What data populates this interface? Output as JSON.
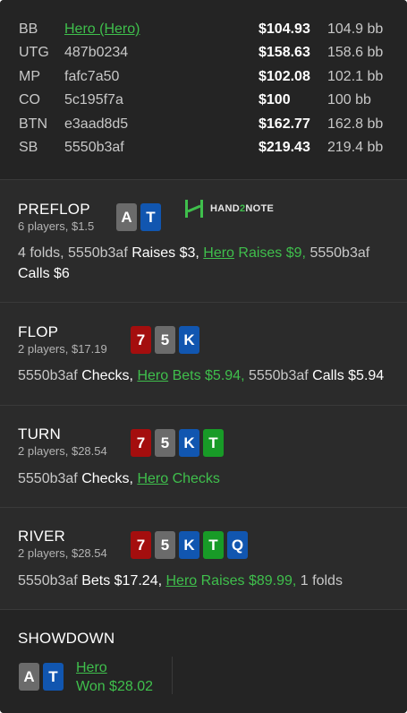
{
  "players": [
    {
      "pos": "BB",
      "name": "Hero (Hero)",
      "stack": "$104.93",
      "bb": "104.9 bb"
    },
    {
      "pos": "UTG",
      "name": "487b0234",
      "stack": "$158.63",
      "bb": "158.6 bb"
    },
    {
      "pos": "MP",
      "name": "fafc7a50",
      "stack": "$102.08",
      "bb": "102.1 bb"
    },
    {
      "pos": "CO",
      "name": "5c195f7a",
      "stack": "$100",
      "bb": "100 bb"
    },
    {
      "pos": "BTN",
      "name": "e3aad8d5",
      "stack": "$162.77",
      "bb": "162.8 bb"
    },
    {
      "pos": "SB",
      "name": "5550b3af",
      "stack": "$219.43",
      "bb": "219.4 bb"
    }
  ],
  "logo": {
    "prefix": "HAND",
    "two": "2",
    "suffix": "NOTE"
  },
  "preflop": {
    "title": "PREFLOP",
    "sub": "6 players, $1.5",
    "cards": [
      "A",
      "T"
    ],
    "action": {
      "p1": "4 folds, 5550b3af ",
      "p2": "Raises $3,",
      "hero": "Hero",
      "p3": " Raises $9,",
      "p4": " 5550b3af ",
      "p5": "Calls $6"
    }
  },
  "flop": {
    "title": "FLOP",
    "sub": "2 players, $17.19",
    "cards": [
      "7",
      "5",
      "K"
    ],
    "action": {
      "p1": "5550b3af ",
      "p2": "Checks,",
      "hero": "Hero",
      "p3": " Bets $5.94,",
      "p4": " 5550b3af ",
      "p5": "Calls $5.94"
    }
  },
  "turn": {
    "title": "TURN",
    "sub": "2 players, $28.54",
    "cards": [
      "7",
      "5",
      "K",
      "T"
    ],
    "action": {
      "p1": "5550b3af ",
      "p2": "Checks,",
      "hero": "Hero",
      "p3": " Checks"
    }
  },
  "river": {
    "title": "RIVER",
    "sub": "2 players, $28.54",
    "cards": [
      "7",
      "5",
      "K",
      "T",
      "Q"
    ],
    "action": {
      "p1": "5550b3af ",
      "p2": "Bets $17.24,",
      "hero": "Hero",
      "p3": " Raises $89.99,",
      "p4": " 1 folds"
    }
  },
  "showdown": {
    "title": "SHOWDOWN",
    "cards": [
      "A",
      "T"
    ],
    "winner_name": "Hero",
    "winner_text": "Won $28.02"
  },
  "colors": {
    "hero_green": "#3fbf4c",
    "card_red": "#a40e0e",
    "card_grey": "#6b6b6b",
    "card_blue": "#1156b0",
    "card_green": "#189b27"
  }
}
